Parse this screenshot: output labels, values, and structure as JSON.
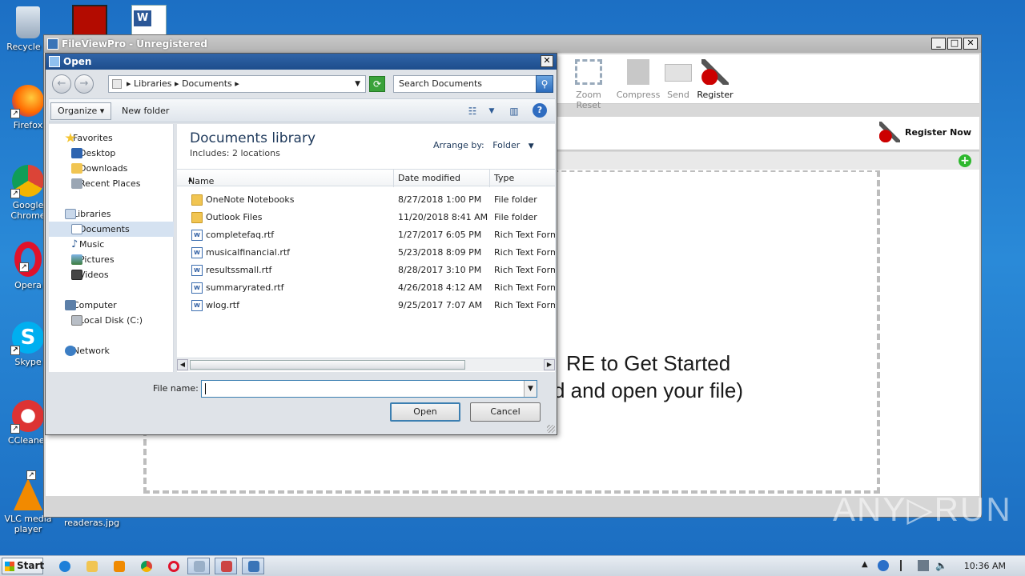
{
  "desktop": {
    "icons": [
      {
        "label": "Recycle B",
        "icon": "recycle-bin-icon"
      },
      {
        "label": "Firefox",
        "icon": "firefox-icon"
      },
      {
        "label": "Google Chrome",
        "icon": "chrome-icon"
      },
      {
        "label": "Opera",
        "icon": "opera-icon"
      },
      {
        "label": "Skype",
        "icon": "skype-icon"
      },
      {
        "label": "CCleaner",
        "icon": "ccleaner-icon"
      },
      {
        "label": "VLC media player",
        "icon": "vlc-icon"
      }
    ],
    "file_label": "readeras.jpg",
    "watermark": "ANY▷RUN"
  },
  "app": {
    "title": "FileViewPro - Unregistered",
    "toolbar": [
      {
        "label": "Zoom Reset",
        "icon": "zoom-reset-icon"
      },
      {
        "label": "Compress",
        "icon": "zip-icon"
      },
      {
        "label": "Send",
        "icon": "envelope-icon"
      },
      {
        "label": "Register",
        "icon": "key-icon"
      }
    ],
    "register_now": "Register Now",
    "drop_line1": "RE to Get Started",
    "drop_line2": "d and open your file)"
  },
  "dialog": {
    "title": "Open",
    "breadcrumb": [
      "Libraries",
      "Documents"
    ],
    "search_placeholder": "Search Documents",
    "organize": "Organize",
    "new_folder": "New folder",
    "nav": {
      "favorites": "Favorites",
      "desktop": "Desktop",
      "downloads": "Downloads",
      "recent": "Recent Places",
      "libraries": "Libraries",
      "documents": "Documents",
      "music": "Music",
      "pictures": "Pictures",
      "videos": "Videos",
      "computer": "Computer",
      "local_disk": "Local Disk (C:)",
      "network": "Network"
    },
    "library_title": "Documents library",
    "library_sub": "Includes:  2 locations",
    "arrange_label": "Arrange by:",
    "arrange_value": "Folder",
    "columns": {
      "name": "Name",
      "date": "Date modified",
      "type": "Type"
    },
    "files": [
      {
        "name": "OneNote Notebooks",
        "date": "8/27/2018 1:00 PM",
        "type": "File folder",
        "kind": "folder"
      },
      {
        "name": "Outlook Files",
        "date": "11/20/2018 8:41 AM",
        "type": "File folder",
        "kind": "folder"
      },
      {
        "name": "completefaq.rtf",
        "date": "1/27/2017 6:05 PM",
        "type": "Rich Text Format",
        "kind": "rtf"
      },
      {
        "name": "musicalfinancial.rtf",
        "date": "5/23/2018 8:09 PM",
        "type": "Rich Text Format",
        "kind": "rtf"
      },
      {
        "name": "resultssmall.rtf",
        "date": "8/28/2017 3:10 PM",
        "type": "Rich Text Format",
        "kind": "rtf"
      },
      {
        "name": "summaryrated.rtf",
        "date": "4/26/2018 4:12 AM",
        "type": "Rich Text Format",
        "kind": "rtf"
      },
      {
        "name": "wlog.rtf",
        "date": "9/25/2017 7:07 AM",
        "type": "Rich Text Format",
        "kind": "rtf"
      }
    ],
    "file_name_label": "File name:",
    "file_name_value": "",
    "open_button": "Open",
    "cancel_button": "Cancel"
  },
  "taskbar": {
    "start_label": "Start",
    "time": "10:36 AM"
  }
}
